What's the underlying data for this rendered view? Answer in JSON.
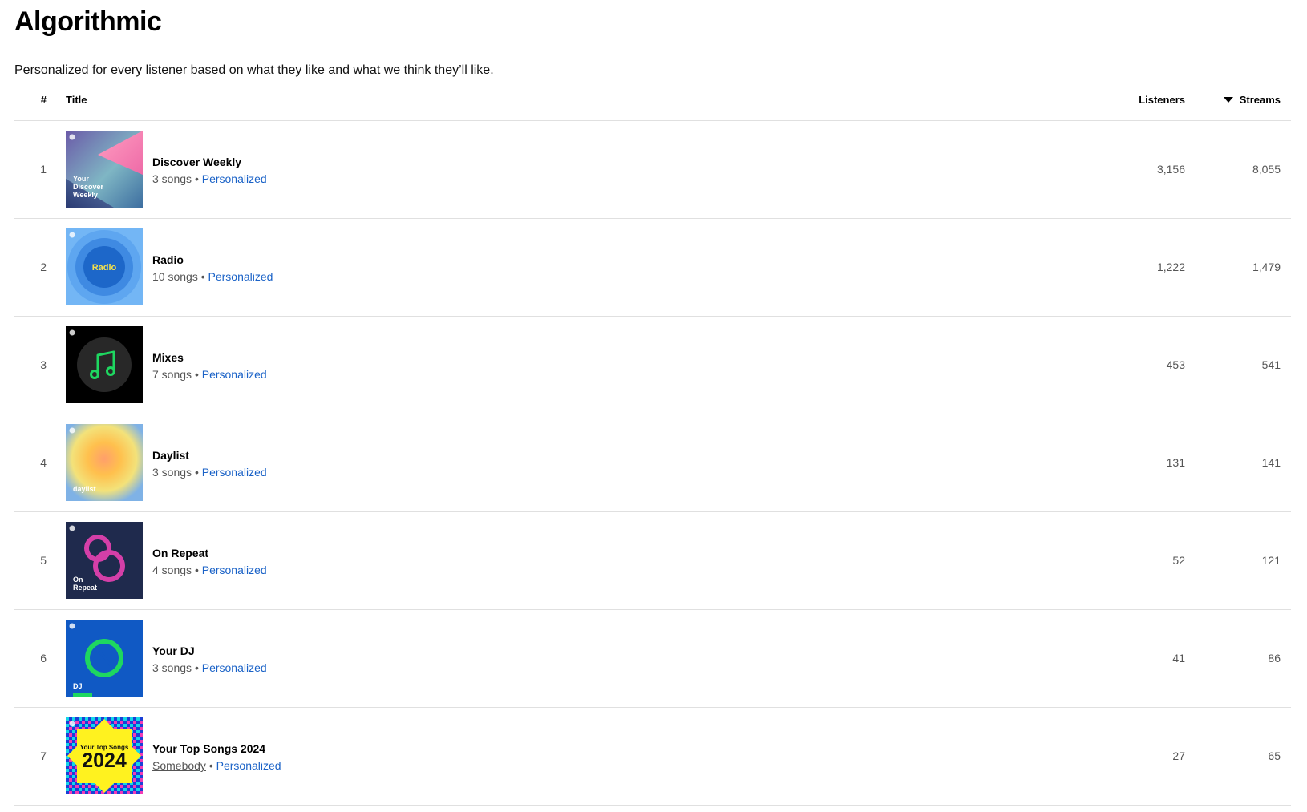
{
  "section": {
    "title": "Algorithmic",
    "description": "Personalized for every listener based on what they like and what we think they’ll like."
  },
  "table": {
    "columns": {
      "index": "#",
      "title": "Title",
      "listeners": "Listeners",
      "streams": "Streams"
    },
    "sort": {
      "column": "streams",
      "direction": "descending"
    },
    "rows": [
      {
        "index": "1",
        "title": "Discover Weekly",
        "count": "3 songs",
        "owner": "",
        "tag": "Personalized",
        "listeners": "3,156",
        "streams": "8,055",
        "cover": {
          "icon": "discover-weekly-cover",
          "text": "Your Discover Weekly"
        }
      },
      {
        "index": "2",
        "title": "Radio",
        "count": "10 songs",
        "owner": "",
        "tag": "Personalized",
        "listeners": "1,222",
        "streams": "1,479",
        "cover": {
          "icon": "radio-cover",
          "text": "Radio"
        }
      },
      {
        "index": "3",
        "title": "Mixes",
        "count": "7 songs",
        "owner": "",
        "tag": "Personalized",
        "listeners": "453",
        "streams": "541",
        "cover": {
          "icon": "music-note-cover",
          "text": ""
        }
      },
      {
        "index": "4",
        "title": "Daylist",
        "count": "3 songs",
        "owner": "",
        "tag": "Personalized",
        "listeners": "131",
        "streams": "141",
        "cover": {
          "icon": "daylist-cover",
          "text": "daylist"
        }
      },
      {
        "index": "5",
        "title": "On Repeat",
        "count": "4 songs",
        "owner": "",
        "tag": "Personalized",
        "listeners": "52",
        "streams": "121",
        "cover": {
          "icon": "on-repeat-cover",
          "text": "On Repeat"
        }
      },
      {
        "index": "6",
        "title": "Your DJ",
        "count": "3 songs",
        "owner": "",
        "tag": "Personalized",
        "listeners": "41",
        "streams": "86",
        "cover": {
          "icon": "dj-cover",
          "text": "DJ"
        }
      },
      {
        "index": "7",
        "title": "Your Top Songs 2024",
        "count": "",
        "owner": "Somebody",
        "tag": "Personalized",
        "listeners": "27",
        "streams": "65",
        "cover": {
          "icon": "top-songs-2024-cover",
          "text": "Your Top Songs 2024"
        }
      }
    ],
    "separator": "•"
  },
  "colors": {
    "link": "#1a62c7",
    "muted_text": "#555555",
    "divider": "#e0e0e0"
  }
}
